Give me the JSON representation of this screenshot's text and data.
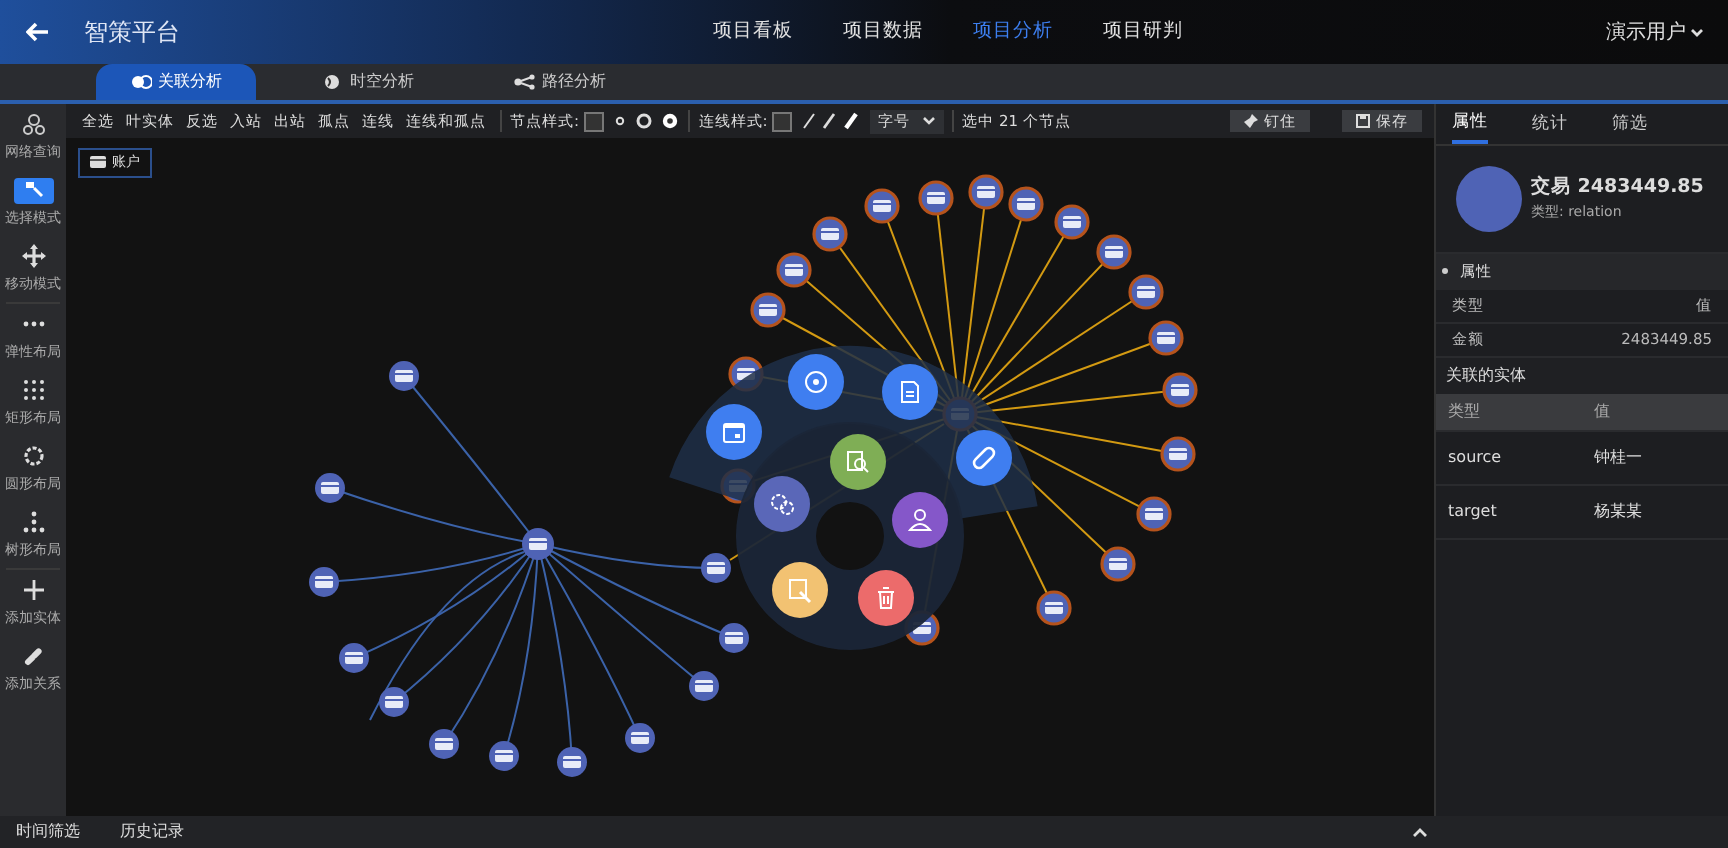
{
  "header": {
    "title": "智策平台",
    "nav": [
      {
        "label": "项目看板",
        "selected": false
      },
      {
        "label": "项目数据",
        "selected": false
      },
      {
        "label": "项目分析",
        "selected": true
      },
      {
        "label": "项目研判",
        "selected": false
      }
    ],
    "user": "演示用户"
  },
  "tabs": [
    {
      "label": "关联分析",
      "selected": true
    },
    {
      "label": "时空分析",
      "selected": false
    },
    {
      "label": "路径分析",
      "selected": false
    }
  ],
  "sidebar": [
    {
      "label": "网络查询",
      "selected": false
    },
    {
      "label": "选择模式",
      "selected": true
    },
    {
      "label": "移动模式",
      "selected": false
    },
    {
      "label": "弹性布局",
      "selected": false
    },
    {
      "label": "矩形布局",
      "selected": false
    },
    {
      "label": "圆形布局",
      "selected": false
    },
    {
      "label": "树形布局",
      "selected": false
    },
    {
      "label": "添加实体",
      "selected": false
    },
    {
      "label": "添加关系",
      "selected": false
    }
  ],
  "toolbar": {
    "actions": [
      "全选",
      "叶实体",
      "反选",
      "入站",
      "出站",
      "孤点",
      "连线",
      "连线和孤点"
    ],
    "node_style_label": "节点样式:",
    "line_style_label": "连线样式:",
    "font_size": "字号",
    "status": "选中 21 个节点",
    "pin": "钉住",
    "save": "保存"
  },
  "legend": "账户",
  "radial_menu": [
    {
      "color": "#3f7ef0"
    },
    {
      "color": "#3f7ef0"
    },
    {
      "color": "#3f7ef0"
    },
    {
      "color": "#3f7ef0"
    },
    {
      "color": "#7fae55"
    },
    {
      "color": "#5a67b8"
    },
    {
      "color": "#8557c9"
    },
    {
      "color": "#f2c272"
    },
    {
      "color": "#ec6b6b"
    }
  ],
  "panel": {
    "tabs": [
      {
        "label": "属性",
        "selected": true
      },
      {
        "label": "统计",
        "selected": false
      },
      {
        "label": "筛选",
        "selected": false
      }
    ],
    "title": "交易 2483449.85",
    "subtitle": "类型: relation",
    "section": "属性",
    "attr_head": [
      "类型",
      "值"
    ],
    "attrs": [
      [
        "金额",
        "2483449.85"
      ]
    ],
    "entities_title": "关联的实体",
    "entity_head": [
      "类型",
      "值"
    ],
    "entities": [
      [
        "source",
        "钟桂一"
      ],
      [
        "target",
        "杨某某"
      ]
    ]
  },
  "footer": {
    "tabs": [
      "时间筛选",
      "历史记录"
    ]
  }
}
